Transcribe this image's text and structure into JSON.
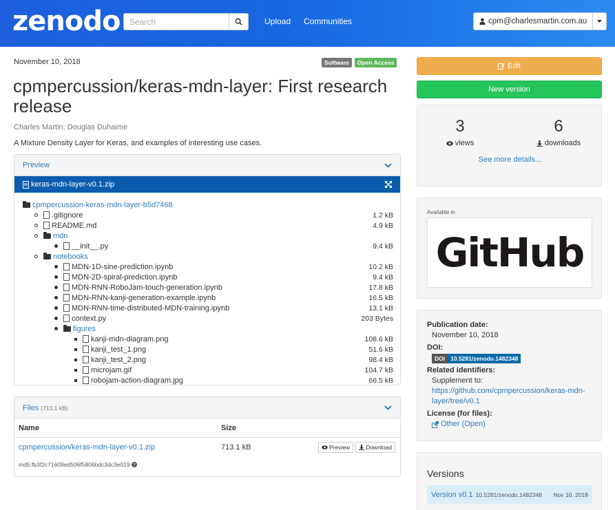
{
  "header": {
    "logo": "zenodo",
    "search_placeholder": "Search",
    "nav": [
      "Upload",
      "Communities"
    ],
    "user_email": "cpm@charlesmartin.com.au"
  },
  "record": {
    "date": "November 10, 2018",
    "badges": [
      "Software",
      "Open Access"
    ],
    "title": "cpmpercussion/keras-mdn-layer: First research release",
    "authors": "Charles Martin; Douglas Duhaime",
    "description": "A Mixture Density Layer for Keras, and examples of interesting use cases."
  },
  "preview": {
    "heading": "Preview",
    "filename": "keras-mdn-layer-v0.1.zip",
    "tree": [
      {
        "level": 0,
        "type": "folder",
        "name": "cpmpercussion-keras-mdn-layer-b5d7468",
        "size": ""
      },
      {
        "level": 1,
        "type": "file",
        "name": ".gitignore",
        "size": "1.2 kB"
      },
      {
        "level": 1,
        "type": "file",
        "name": "README.md",
        "size": "4.9 kB"
      },
      {
        "level": 1,
        "type": "folder",
        "name": "mdn",
        "size": ""
      },
      {
        "level": 2,
        "type": "file",
        "name": "__init__.py",
        "size": "9.4 kB"
      },
      {
        "level": 1,
        "type": "folder",
        "name": "notebooks",
        "size": ""
      },
      {
        "level": 2,
        "type": "file",
        "name": "MDN-1D-sine-prediction.ipynb",
        "size": "10.2 kB"
      },
      {
        "level": 2,
        "type": "file",
        "name": "MDN-2D-spiral-prediction.ipynb",
        "size": "9.4 kB"
      },
      {
        "level": 2,
        "type": "file",
        "name": "MDN-RNN-RoboJam-touch-generation.ipynb",
        "size": "17.8 kB"
      },
      {
        "level": 2,
        "type": "file",
        "name": "MDN-RNN-kanji-generation-example.ipynb",
        "size": "16.5 kB"
      },
      {
        "level": 2,
        "type": "file",
        "name": "MDN-RNN-time-distributed-MDN-training.ipynb",
        "size": "13.1 kB"
      },
      {
        "level": 2,
        "type": "file",
        "name": "context.py",
        "size": "203 Bytes"
      },
      {
        "level": 2,
        "type": "folder",
        "name": "figures",
        "size": ""
      },
      {
        "level": 3,
        "type": "file",
        "name": "kanji-mdn-diagram.png",
        "size": "108.6 kB"
      },
      {
        "level": 3,
        "type": "file",
        "name": "kanji_test_1.png",
        "size": "51.6 kB"
      },
      {
        "level": 3,
        "type": "file",
        "name": "kanji_test_2.png",
        "size": "98.4 kB"
      },
      {
        "level": 3,
        "type": "file",
        "name": "microjam.gif",
        "size": "104.7 kB"
      },
      {
        "level": 3,
        "type": "file",
        "name": "robojam-action-diagram.jpg",
        "size": "66.5 kB"
      }
    ]
  },
  "files": {
    "heading": "Files",
    "total": "(713.1 kB)",
    "col_name": "Name",
    "col_size": "Size",
    "file_name": "cpmpercussion/keras-mdn-layer-v0.1.zip",
    "file_size": "713.1 kB",
    "preview_label": "Preview",
    "download_label": "Download",
    "md5": "md5:fb3f2c71609ed506f5806bdc3dc3e019"
  },
  "actions": {
    "edit": "Edit",
    "new_version": "New version"
  },
  "stats": {
    "views": "3",
    "views_label": "views",
    "downloads": "6",
    "downloads_label": "downloads",
    "see_more": "See more details..."
  },
  "available": {
    "label": "Available in",
    "logo_text": "GitHub"
  },
  "meta": {
    "pub_date_label": "Publication date:",
    "pub_date": "November 10, 2018",
    "doi_label": "DOI:",
    "doi_prefix": "DOI",
    "doi": "10.5281/zenodo.1482348",
    "related_label": "Related identifiers:",
    "supplement": "Supplement to:",
    "related_url": "https://github.com/cpmpercussion/keras-mdn-layer/tree/v0.1",
    "license_label": "License (for files):",
    "license": "Other (Open)"
  },
  "versions": {
    "heading": "Versions",
    "rows": [
      {
        "name": "Version v0.1",
        "doi": "10.5281/zenodo.1482348",
        "date": "Nov 10, 2018"
      }
    ]
  },
  "colors": {
    "header_blue": "#1766e0",
    "link": "#337ab7",
    "edit": "#f0ad4e",
    "new_version": "#26c55c",
    "preview_bar": "#0b5cad"
  }
}
